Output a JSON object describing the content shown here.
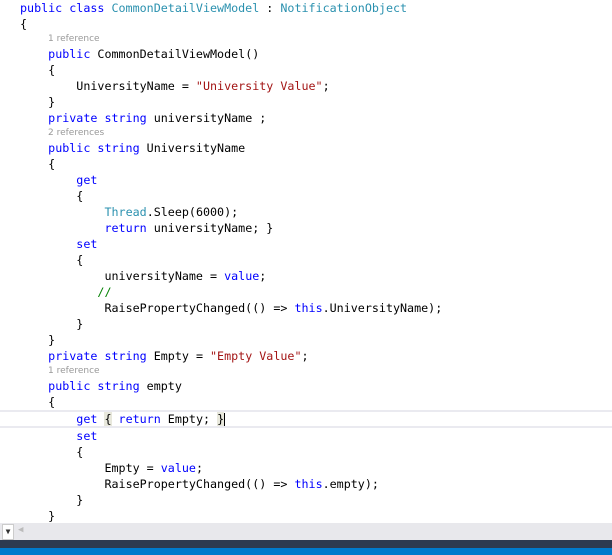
{
  "colors": {
    "keyword": "#0000ff",
    "type": "#2b91af",
    "string": "#a31515",
    "comment": "#008000",
    "reference": "#999999",
    "status_bar": "#007acc"
  },
  "lines": [
    {
      "k": "code",
      "i": 0,
      "tokens": [
        [
          "kw",
          "public class "
        ],
        [
          "ty",
          "CommonDetailViewModel"
        ],
        [
          "pl",
          " : "
        ],
        [
          "ty",
          "NotificationObject"
        ]
      ]
    },
    {
      "k": "code",
      "i": 0,
      "tokens": [
        [
          "pl",
          "{"
        ]
      ]
    },
    {
      "k": "ref",
      "i": 4,
      "text": "1 reference"
    },
    {
      "k": "code",
      "i": 4,
      "tokens": [
        [
          "kw",
          "public "
        ],
        [
          "pl",
          "CommonDetailViewModel()"
        ]
      ]
    },
    {
      "k": "code",
      "i": 4,
      "tokens": [
        [
          "pl",
          "{"
        ]
      ]
    },
    {
      "k": "code",
      "i": 8,
      "tokens": [
        [
          "pl",
          "UniversityName = "
        ],
        [
          "st",
          "\"University Value\""
        ],
        [
          "pl",
          ";"
        ]
      ]
    },
    {
      "k": "code",
      "i": 4,
      "tokens": [
        [
          "pl",
          "}"
        ]
      ]
    },
    {
      "k": "code",
      "i": 4,
      "tokens": [
        [
          "kw",
          "private string "
        ],
        [
          "pl",
          "universityName ;"
        ]
      ]
    },
    {
      "k": "ref",
      "i": 4,
      "text": "2 references"
    },
    {
      "k": "code",
      "i": 4,
      "tokens": [
        [
          "kw",
          "public string "
        ],
        [
          "pl",
          "UniversityName"
        ]
      ]
    },
    {
      "k": "code",
      "i": 4,
      "tokens": [
        [
          "pl",
          "{"
        ]
      ]
    },
    {
      "k": "code",
      "i": 8,
      "tokens": [
        [
          "kw",
          "get"
        ]
      ]
    },
    {
      "k": "code",
      "i": 8,
      "tokens": [
        [
          "pl",
          "{"
        ]
      ]
    },
    {
      "k": "code",
      "i": 12,
      "tokens": [
        [
          "ty",
          "Thread"
        ],
        [
          "pl",
          ".Sleep(6000);"
        ]
      ]
    },
    {
      "k": "code",
      "i": 12,
      "tokens": [
        [
          "kw",
          "return "
        ],
        [
          "pl",
          "universityName; }"
        ]
      ]
    },
    {
      "k": "code",
      "i": 8,
      "tokens": [
        [
          "kw",
          "set"
        ]
      ]
    },
    {
      "k": "code",
      "i": 8,
      "tokens": [
        [
          "pl",
          "{"
        ]
      ]
    },
    {
      "k": "code",
      "i": 12,
      "tokens": [
        [
          "pl",
          "universityName = "
        ],
        [
          "kw",
          "value"
        ],
        [
          "pl",
          ";"
        ]
      ]
    },
    {
      "k": "code",
      "i": 11,
      "tokens": [
        [
          "cm",
          "//"
        ]
      ]
    },
    {
      "k": "code",
      "i": 12,
      "tokens": [
        [
          "pl",
          "RaisePropertyChanged(() => "
        ],
        [
          "kw",
          "this"
        ],
        [
          "pl",
          ".UniversityName);"
        ]
      ]
    },
    {
      "k": "code",
      "i": 8,
      "tokens": [
        [
          "pl",
          "}"
        ]
      ]
    },
    {
      "k": "code",
      "i": 4,
      "tokens": [
        [
          "pl",
          "}"
        ]
      ]
    },
    {
      "k": "code",
      "i": 4,
      "tokens": [
        [
          "kw",
          "private string "
        ],
        [
          "pl",
          "Empty = "
        ],
        [
          "st",
          "\"Empty Value\""
        ],
        [
          "pl",
          ";"
        ]
      ]
    },
    {
      "k": "ref",
      "i": 4,
      "text": "1 reference"
    },
    {
      "k": "code",
      "i": 4,
      "tokens": [
        [
          "kw",
          "public string "
        ],
        [
          "pl",
          "empty"
        ]
      ]
    },
    {
      "k": "code",
      "i": 4,
      "tokens": [
        [
          "pl",
          "{"
        ]
      ]
    },
    {
      "k": "code",
      "i": 8,
      "current": true,
      "tokens": [
        [
          "kw",
          "get "
        ],
        [
          "hl",
          "{"
        ],
        [
          "kw",
          " return "
        ],
        [
          "pl",
          "Empty; "
        ],
        [
          "hl",
          "}"
        ]
      ]
    },
    {
      "k": "code",
      "i": 8,
      "tokens": [
        [
          "kw",
          "set"
        ]
      ]
    },
    {
      "k": "code",
      "i": 8,
      "tokens": [
        [
          "pl",
          "{"
        ]
      ]
    },
    {
      "k": "code",
      "i": 12,
      "tokens": [
        [
          "pl",
          "Empty = "
        ],
        [
          "kw",
          "value"
        ],
        [
          "pl",
          ";"
        ]
      ]
    },
    {
      "k": "code",
      "i": 12,
      "tokens": [
        [
          "pl",
          "RaisePropertyChanged(() => "
        ],
        [
          "kw",
          "this"
        ],
        [
          "pl",
          ".empty);"
        ]
      ]
    },
    {
      "k": "code",
      "i": 8,
      "tokens": [
        [
          "pl",
          "}"
        ]
      ]
    },
    {
      "k": "code",
      "i": 4,
      "tokens": [
        [
          "pl",
          "}"
        ]
      ]
    }
  ]
}
